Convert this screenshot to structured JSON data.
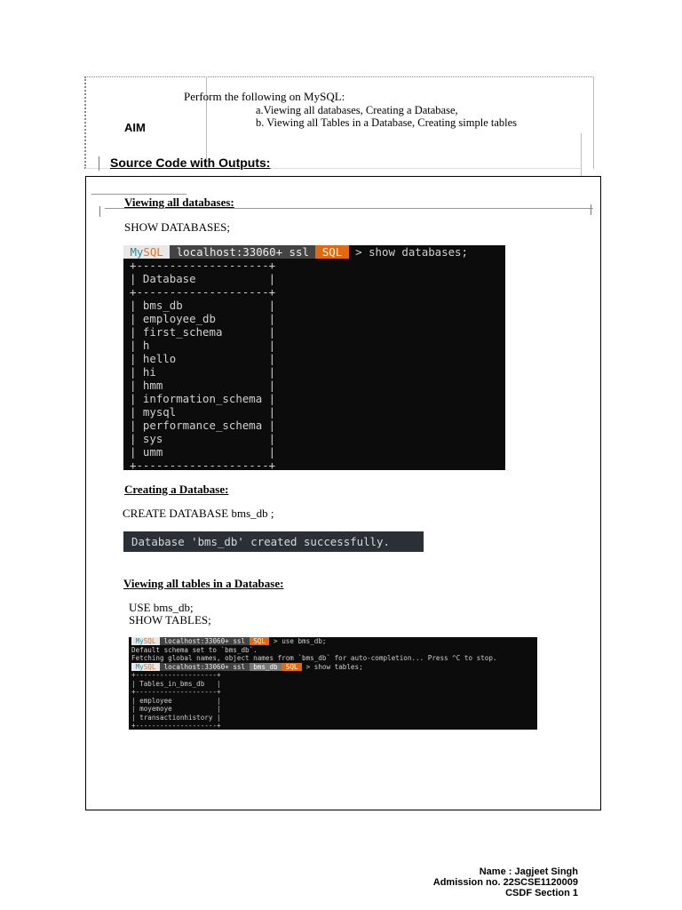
{
  "aim": {
    "label": "AIM",
    "intro": "Perform the following on MySQL:",
    "items": [
      "a.Viewing all databases, Creating a   Database,",
      "b. Viewing all Tables in a Database, Creating simple tables"
    ]
  },
  "source_heading": "Source Code with Outputs:",
  "sections": [
    {
      "heading": "Viewing all databases:",
      "code": "SHOW DATABASES;"
    },
    {
      "heading": "Creating a Database:",
      "code": "CREATE DATABASE bms_db ;"
    },
    {
      "heading": "Viewing all tables in a Database:",
      "code_lines": [
        "USE bms_db;",
        "SHOW TABLES;"
      ]
    }
  ],
  "terminal1": {
    "prompt": {
      "my": "My",
      "sql": "SQL",
      "host": " localhost:33060+ ssl ",
      "mode": " SQL ",
      "command": " > show databases;"
    },
    "lines": [
      "+--------------------+",
      "| Database           |",
      "+--------------------+",
      "| bms_db             |",
      "| employee_db        |",
      "| first_schema       |",
      "| h                  |",
      "| hello              |",
      "| hi                 |",
      "| hmm                |",
      "| information_schema |",
      "| mysql              |",
      "| performance_schema |",
      "| sys                |",
      "| umm                |",
      "+--------------------+"
    ]
  },
  "terminal2": {
    "message": "Database 'bms_db' created successfully."
  },
  "terminal3": {
    "prompt1": {
      "my": "My",
      "sql": "SQL",
      "host": " localhost:33060+ ssl ",
      "mode": " SQL ",
      "command": " > use bms_db;"
    },
    "messages": [
      "Default schema set to `bms_db`.",
      "Fetching global names, object names from `bms_db` for auto-completion... Press ^C to stop."
    ],
    "prompt2": {
      "my": "My",
      "sql": "SQL",
      "host": " localhost:33060+ ssl ",
      "db": " bms_db ",
      "mode": " SQL ",
      "command": " > show tables;"
    },
    "lines": [
      "+--------------------+",
      "| Tables_in_bms_db   |",
      "+--------------------+",
      "| employee           |",
      "| moyemoye           |",
      "| transactionhistory |",
      "+--------------------+"
    ]
  },
  "footer": {
    "name": "Name : Jagjeet Singh",
    "admission": "Admission no. 22SCSE1120009",
    "section": "CSDF Section 1"
  }
}
